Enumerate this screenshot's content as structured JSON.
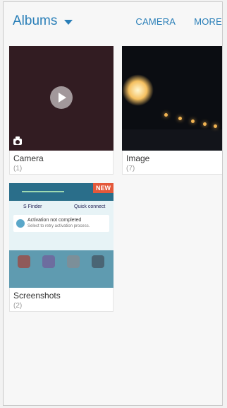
{
  "header": {
    "title": "Albums",
    "actions": [
      "CAMERA",
      "MORE"
    ]
  },
  "albums": [
    {
      "name": "Camera",
      "count": "(1)"
    },
    {
      "name": "Image",
      "count": "(7)"
    },
    {
      "name": "Screenshots",
      "count": "(2)"
    }
  ],
  "screenshots_thumb": {
    "badge": "NEW",
    "chips": [
      "S Finder",
      "Quick connect"
    ],
    "note_title": "Activation not completed",
    "note_subtitle": "Select to retry activation process."
  }
}
